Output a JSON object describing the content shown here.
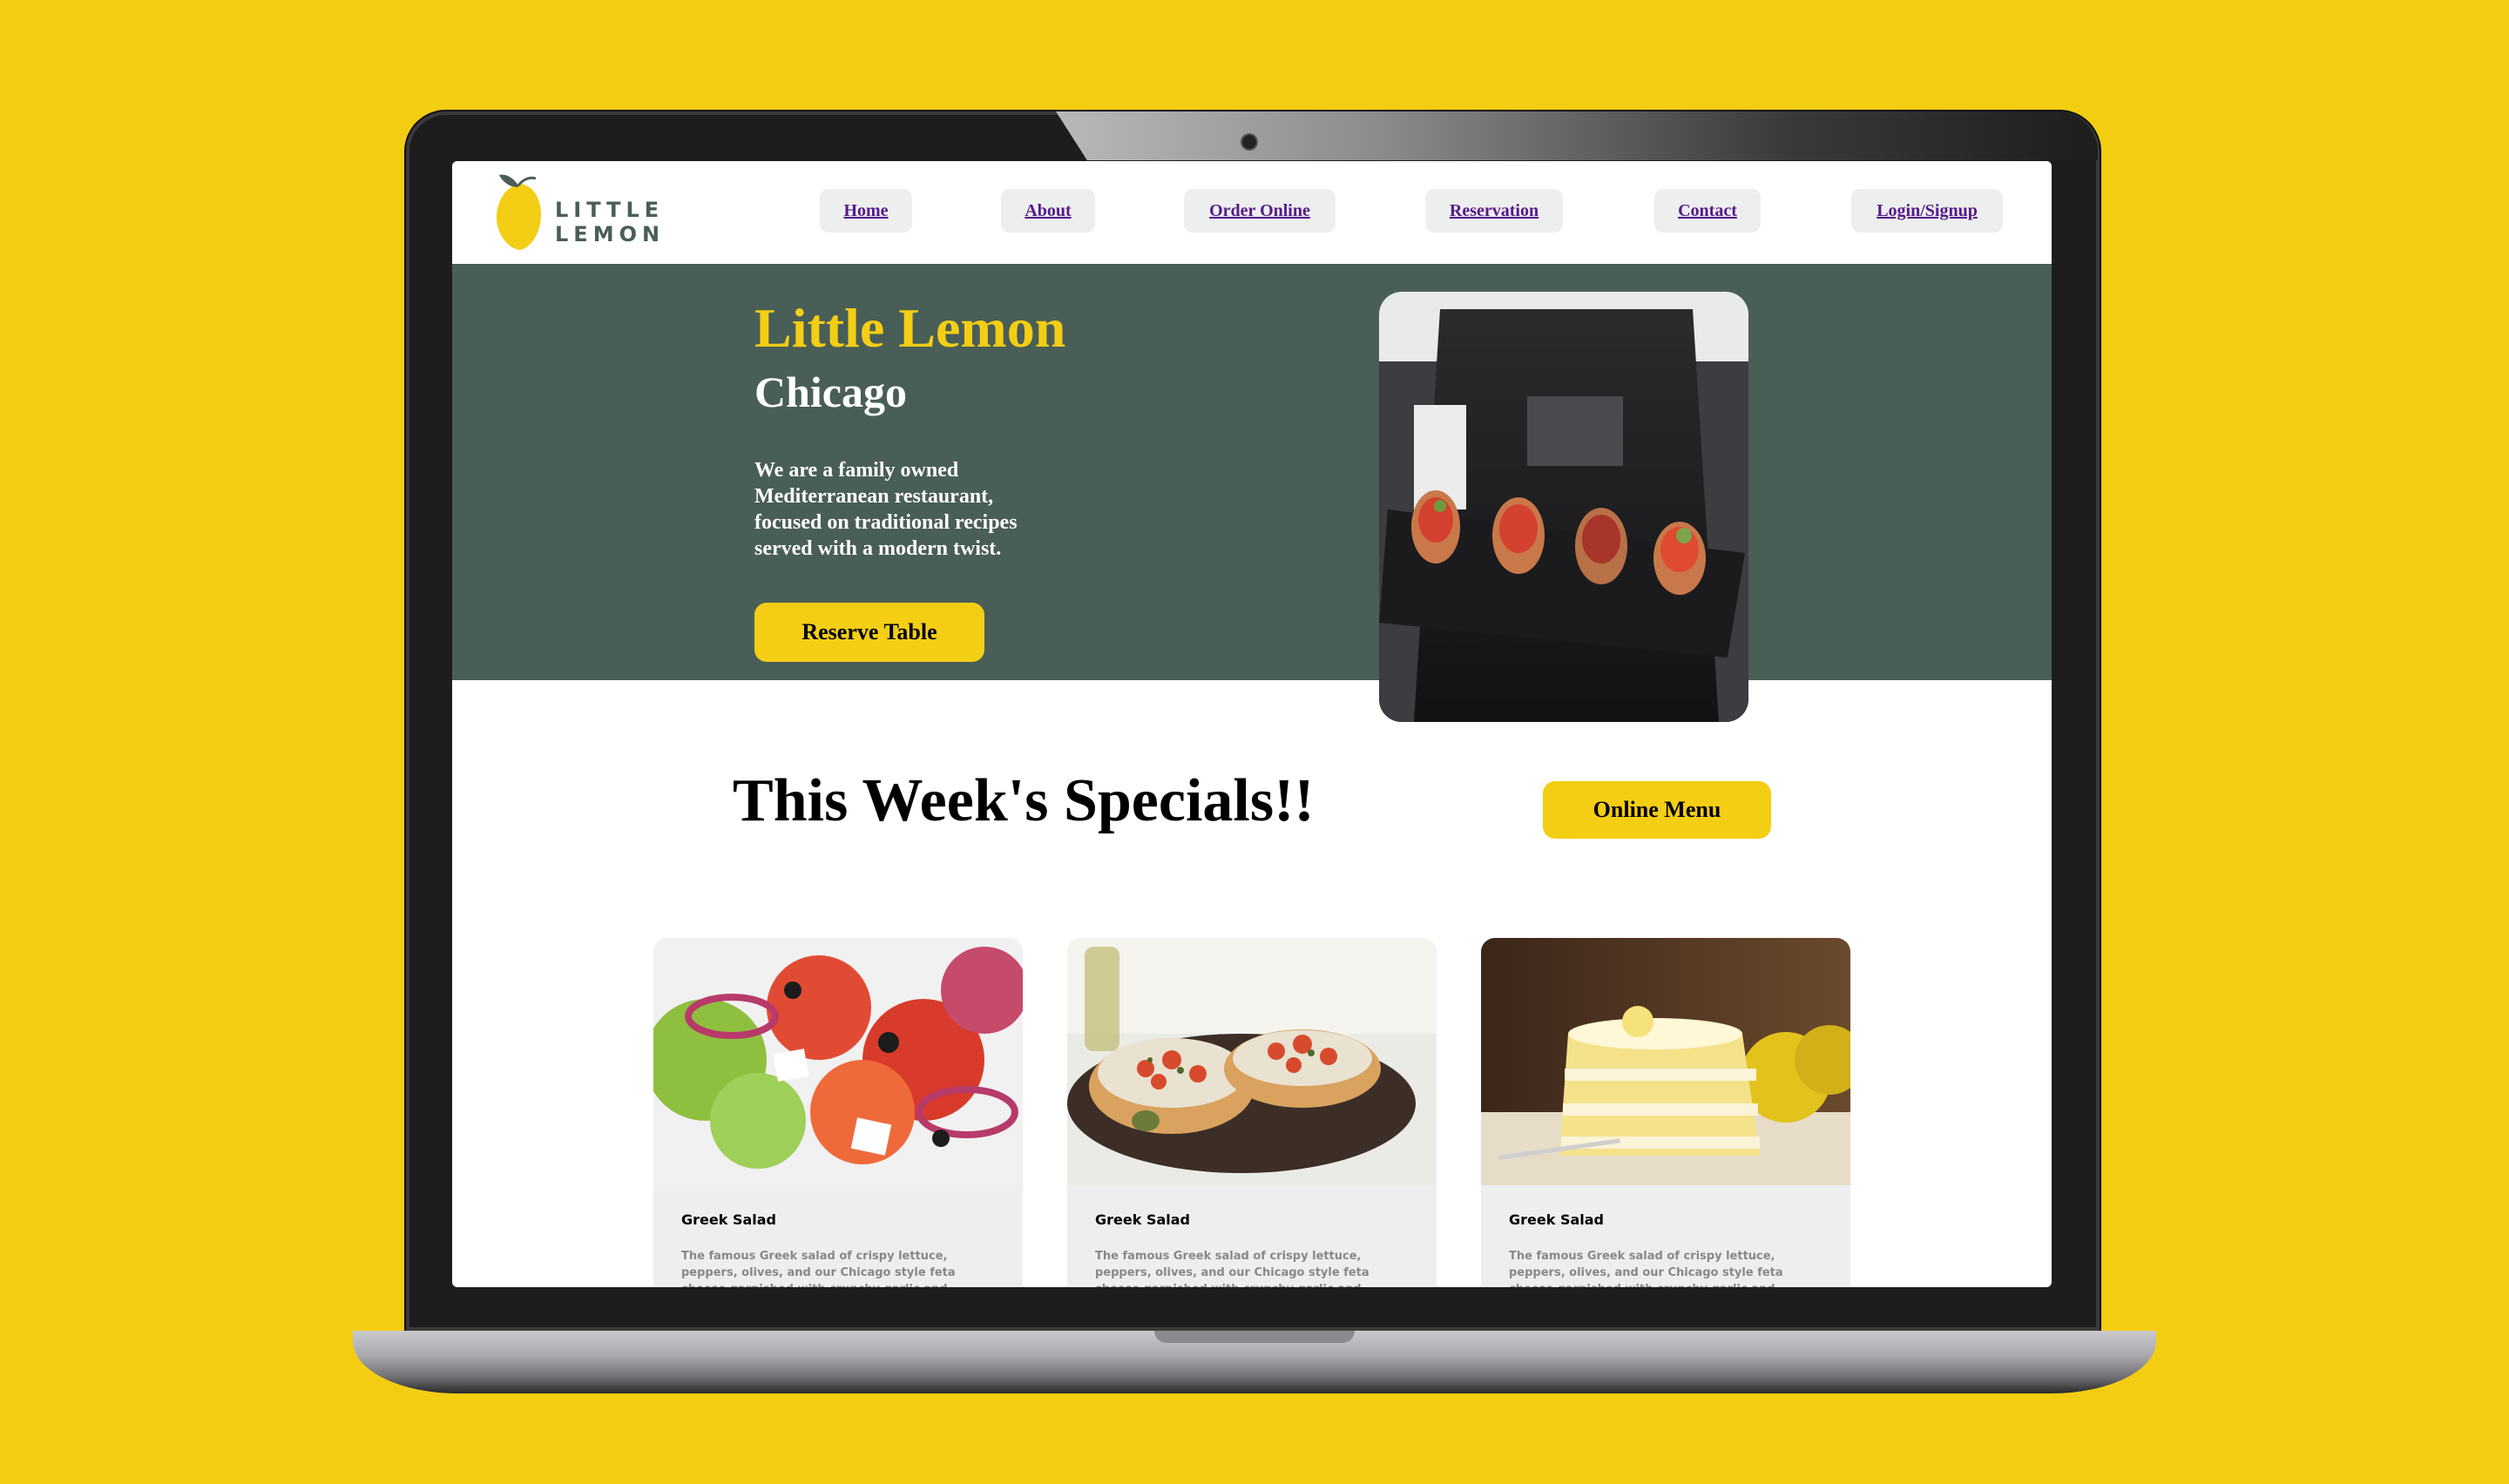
{
  "brand": {
    "name": "LITTLE LEMON"
  },
  "nav": {
    "items": [
      {
        "label": "Home"
      },
      {
        "label": "About"
      },
      {
        "label": "Order Online"
      },
      {
        "label": "Reservation"
      },
      {
        "label": "Contact"
      },
      {
        "label": "Login/Signup"
      }
    ]
  },
  "hero": {
    "title": "Little Lemon",
    "subtitle": "Chicago",
    "description": "We are a family owned Mediterranean restaurant, focused on traditional recipes served with a modern twist.",
    "button_label": "Reserve Table"
  },
  "specials": {
    "title": "This Week's Specials!!",
    "menu_button_label": "Online Menu",
    "cards": [
      {
        "title": "Greek Salad",
        "description": "The famous Greek salad of crispy lettuce, peppers, olives, and our Chicago style feta cheese garnished with crunchy garlic and rosemary croutons."
      },
      {
        "title": "Greek Salad",
        "description": "The famous Greek salad of crispy lettuce, peppers, olives, and our Chicago style feta cheese garnished with crunchy garlic and rosemary croutons."
      },
      {
        "title": "Greek Salad",
        "description": "The famous Greek salad of crispy lettuce, peppers, olives, and our Chicago style feta cheese garnished with crunchy garlic and rosemary croutons."
      }
    ]
  },
  "colors": {
    "background": "#F3CD12",
    "primary_green": "#495E57",
    "primary_yellow": "#F4CE14",
    "light_gray": "#EDEFEE",
    "link": "#551A8B"
  }
}
